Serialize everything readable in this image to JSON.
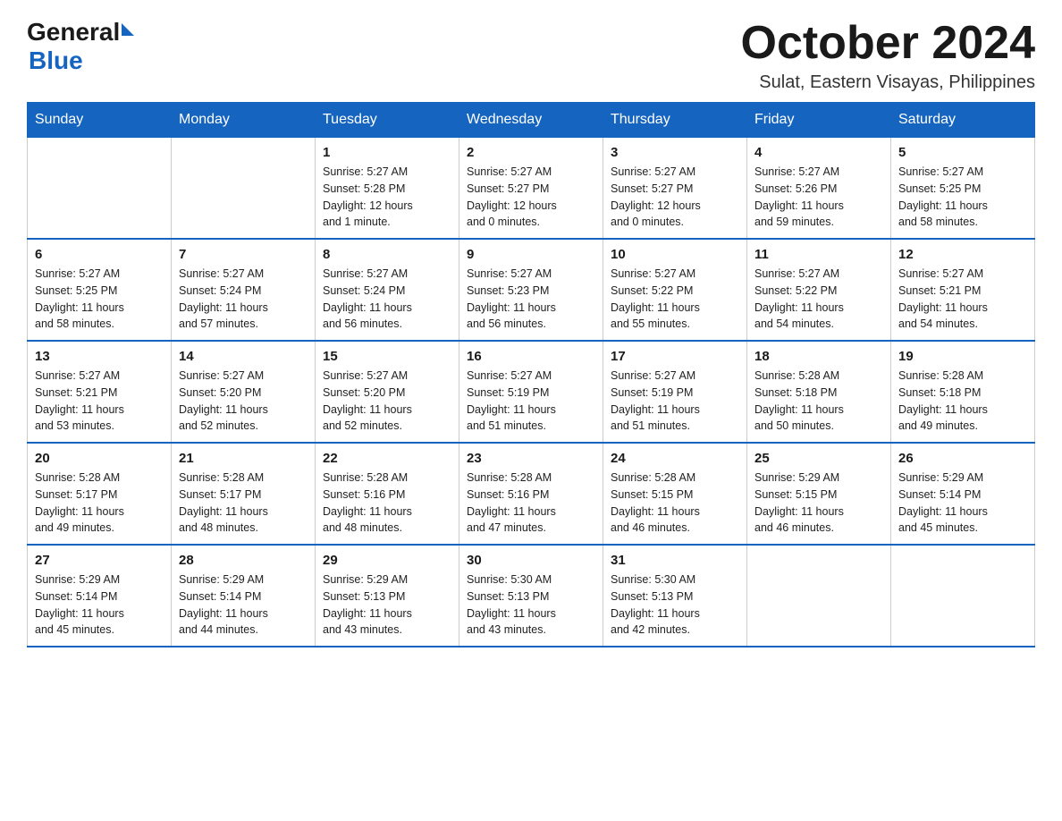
{
  "logo": {
    "general": "General",
    "blue": "Blue"
  },
  "header": {
    "month": "October 2024",
    "location": "Sulat, Eastern Visayas, Philippines"
  },
  "weekdays": [
    "Sunday",
    "Monday",
    "Tuesday",
    "Wednesday",
    "Thursday",
    "Friday",
    "Saturday"
  ],
  "weeks": [
    [
      {
        "day": "",
        "info": ""
      },
      {
        "day": "",
        "info": ""
      },
      {
        "day": "1",
        "info": "Sunrise: 5:27 AM\nSunset: 5:28 PM\nDaylight: 12 hours\nand 1 minute."
      },
      {
        "day": "2",
        "info": "Sunrise: 5:27 AM\nSunset: 5:27 PM\nDaylight: 12 hours\nand 0 minutes."
      },
      {
        "day": "3",
        "info": "Sunrise: 5:27 AM\nSunset: 5:27 PM\nDaylight: 12 hours\nand 0 minutes."
      },
      {
        "day": "4",
        "info": "Sunrise: 5:27 AM\nSunset: 5:26 PM\nDaylight: 11 hours\nand 59 minutes."
      },
      {
        "day": "5",
        "info": "Sunrise: 5:27 AM\nSunset: 5:25 PM\nDaylight: 11 hours\nand 58 minutes."
      }
    ],
    [
      {
        "day": "6",
        "info": "Sunrise: 5:27 AM\nSunset: 5:25 PM\nDaylight: 11 hours\nand 58 minutes."
      },
      {
        "day": "7",
        "info": "Sunrise: 5:27 AM\nSunset: 5:24 PM\nDaylight: 11 hours\nand 57 minutes."
      },
      {
        "day": "8",
        "info": "Sunrise: 5:27 AM\nSunset: 5:24 PM\nDaylight: 11 hours\nand 56 minutes."
      },
      {
        "day": "9",
        "info": "Sunrise: 5:27 AM\nSunset: 5:23 PM\nDaylight: 11 hours\nand 56 minutes."
      },
      {
        "day": "10",
        "info": "Sunrise: 5:27 AM\nSunset: 5:22 PM\nDaylight: 11 hours\nand 55 minutes."
      },
      {
        "day": "11",
        "info": "Sunrise: 5:27 AM\nSunset: 5:22 PM\nDaylight: 11 hours\nand 54 minutes."
      },
      {
        "day": "12",
        "info": "Sunrise: 5:27 AM\nSunset: 5:21 PM\nDaylight: 11 hours\nand 54 minutes."
      }
    ],
    [
      {
        "day": "13",
        "info": "Sunrise: 5:27 AM\nSunset: 5:21 PM\nDaylight: 11 hours\nand 53 minutes."
      },
      {
        "day": "14",
        "info": "Sunrise: 5:27 AM\nSunset: 5:20 PM\nDaylight: 11 hours\nand 52 minutes."
      },
      {
        "day": "15",
        "info": "Sunrise: 5:27 AM\nSunset: 5:20 PM\nDaylight: 11 hours\nand 52 minutes."
      },
      {
        "day": "16",
        "info": "Sunrise: 5:27 AM\nSunset: 5:19 PM\nDaylight: 11 hours\nand 51 minutes."
      },
      {
        "day": "17",
        "info": "Sunrise: 5:27 AM\nSunset: 5:19 PM\nDaylight: 11 hours\nand 51 minutes."
      },
      {
        "day": "18",
        "info": "Sunrise: 5:28 AM\nSunset: 5:18 PM\nDaylight: 11 hours\nand 50 minutes."
      },
      {
        "day": "19",
        "info": "Sunrise: 5:28 AM\nSunset: 5:18 PM\nDaylight: 11 hours\nand 49 minutes."
      }
    ],
    [
      {
        "day": "20",
        "info": "Sunrise: 5:28 AM\nSunset: 5:17 PM\nDaylight: 11 hours\nand 49 minutes."
      },
      {
        "day": "21",
        "info": "Sunrise: 5:28 AM\nSunset: 5:17 PM\nDaylight: 11 hours\nand 48 minutes."
      },
      {
        "day": "22",
        "info": "Sunrise: 5:28 AM\nSunset: 5:16 PM\nDaylight: 11 hours\nand 48 minutes."
      },
      {
        "day": "23",
        "info": "Sunrise: 5:28 AM\nSunset: 5:16 PM\nDaylight: 11 hours\nand 47 minutes."
      },
      {
        "day": "24",
        "info": "Sunrise: 5:28 AM\nSunset: 5:15 PM\nDaylight: 11 hours\nand 46 minutes."
      },
      {
        "day": "25",
        "info": "Sunrise: 5:29 AM\nSunset: 5:15 PM\nDaylight: 11 hours\nand 46 minutes."
      },
      {
        "day": "26",
        "info": "Sunrise: 5:29 AM\nSunset: 5:14 PM\nDaylight: 11 hours\nand 45 minutes."
      }
    ],
    [
      {
        "day": "27",
        "info": "Sunrise: 5:29 AM\nSunset: 5:14 PM\nDaylight: 11 hours\nand 45 minutes."
      },
      {
        "day": "28",
        "info": "Sunrise: 5:29 AM\nSunset: 5:14 PM\nDaylight: 11 hours\nand 44 minutes."
      },
      {
        "day": "29",
        "info": "Sunrise: 5:29 AM\nSunset: 5:13 PM\nDaylight: 11 hours\nand 43 minutes."
      },
      {
        "day": "30",
        "info": "Sunrise: 5:30 AM\nSunset: 5:13 PM\nDaylight: 11 hours\nand 43 minutes."
      },
      {
        "day": "31",
        "info": "Sunrise: 5:30 AM\nSunset: 5:13 PM\nDaylight: 11 hours\nand 42 minutes."
      },
      {
        "day": "",
        "info": ""
      },
      {
        "day": "",
        "info": ""
      }
    ]
  ]
}
